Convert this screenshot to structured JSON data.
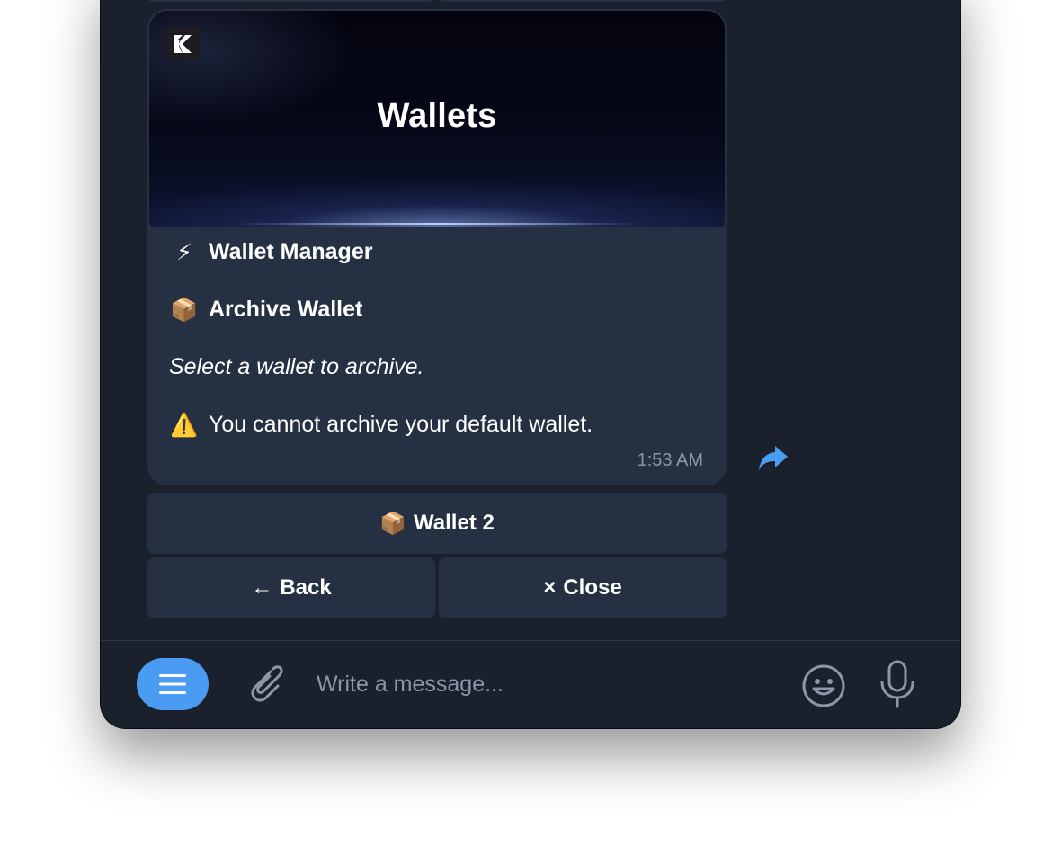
{
  "banner": {
    "title": "Wallets",
    "logo_icon": "k-logo-icon"
  },
  "message": {
    "lines": [
      {
        "emoji": "⚡",
        "text": "Wallet Manager",
        "style": "bold"
      },
      {
        "emoji": "📦",
        "text": "Archive Wallet",
        "style": "bold"
      },
      {
        "emoji": "",
        "text": "Select a wallet to archive.",
        "style": "italic"
      },
      {
        "emoji": "⚠️",
        "text": "You cannot archive your default wallet.",
        "style": "regular"
      }
    ],
    "timestamp": "1:53 AM",
    "share_icon": "share-arrow-icon"
  },
  "keyboard": {
    "wallet_button": {
      "emoji": "📦",
      "label": "Wallet 2"
    },
    "back_button": {
      "glyph": "←",
      "label": "Back"
    },
    "close_button": {
      "glyph": "×",
      "label": "Close"
    }
  },
  "composer": {
    "placeholder": "Write a message...",
    "menu_icon": "menu-lines-icon",
    "attach_icon": "paperclip-icon",
    "emoji_icon": "smiley-icon",
    "mic_icon": "microphone-icon"
  },
  "colors": {
    "background": "#1a212c",
    "bubble": "#253142",
    "accent": "#4a9bf2",
    "muted_text": "#8a97a8"
  }
}
